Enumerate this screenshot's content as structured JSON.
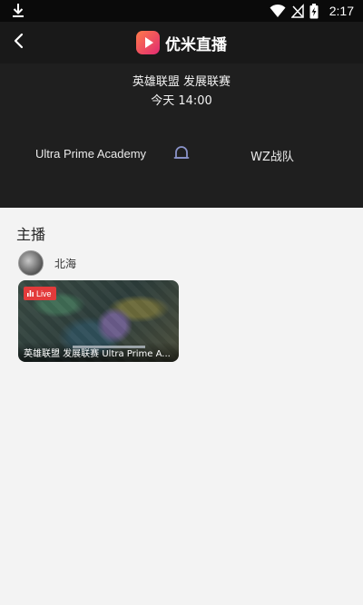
{
  "status_bar": {
    "time": "2:17",
    "icons": [
      "download-icon",
      "wifi-icon",
      "no-signal-icon",
      "battery-charging-icon"
    ]
  },
  "app": {
    "name": "优米直播",
    "back_icon": "back-arrow-icon",
    "logo_icon": "play-logo-icon"
  },
  "match": {
    "title": "英雄联盟 发展联赛",
    "time": "今天 14:00",
    "team_a": "Ultra Prime Academy",
    "team_b": "WZ战队",
    "reminder_icon": "bell-icon"
  },
  "section": {
    "title": "主播"
  },
  "streamer": {
    "name": "北海"
  },
  "stream_card": {
    "badge": "Live",
    "title": "英雄联盟 发展联赛 Ultra Prime A..."
  },
  "colors": {
    "header_bg": "#1f1f1f",
    "page_bg": "#f3f3f3",
    "live_red": "#e33b3b",
    "logo_gradient_start": "#ff7a4a",
    "logo_gradient_end": "#e02a72"
  }
}
